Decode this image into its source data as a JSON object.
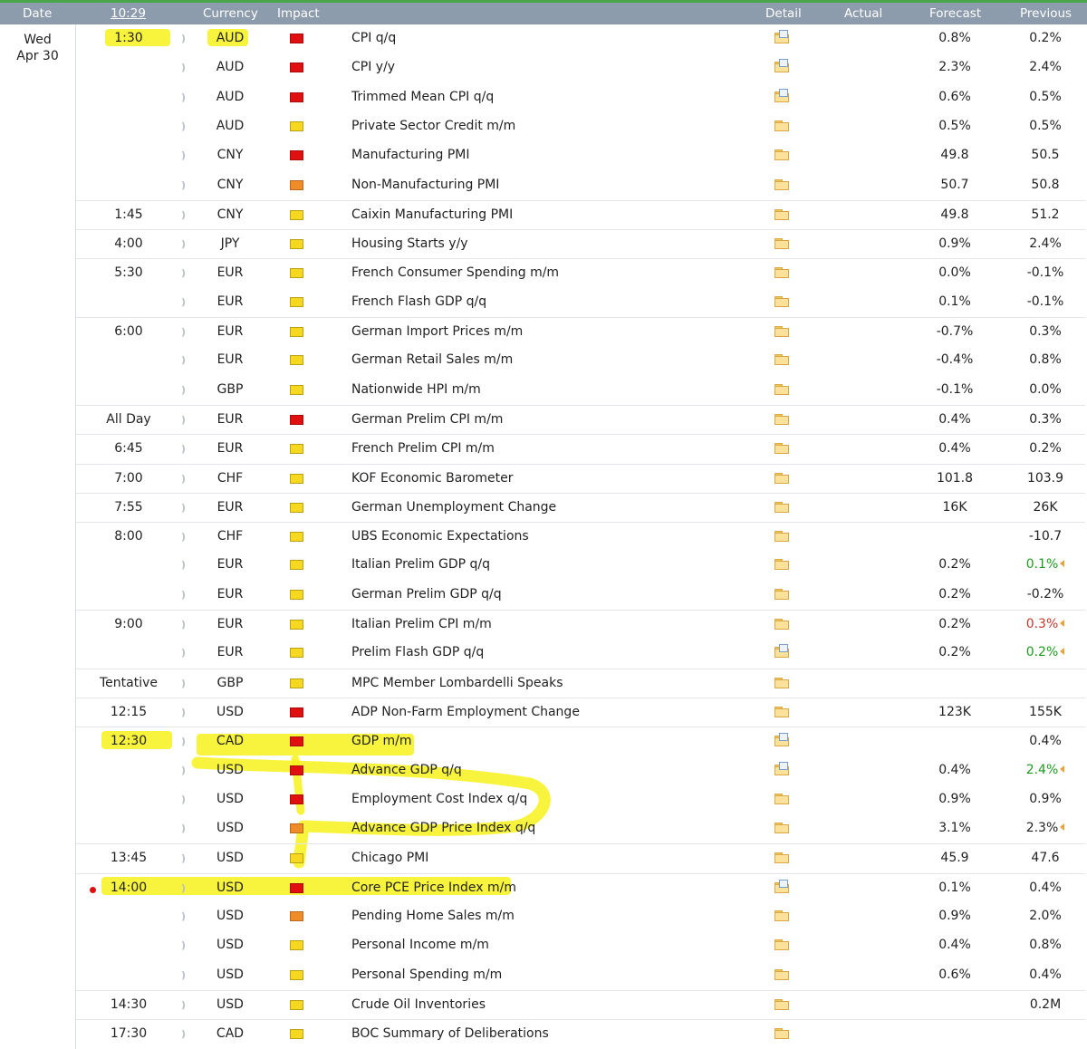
{
  "header": {
    "date": "Date",
    "time": "10:29",
    "currency": "Currency",
    "impact": "Impact",
    "detail": "Detail",
    "actual": "Actual",
    "forecast": "Forecast",
    "previous": "Previous"
  },
  "day": {
    "weekday": "Wed",
    "date": "Apr 30"
  },
  "colors": {
    "high": "#e01010",
    "medium": "#f08c28",
    "low": "#f7d820",
    "highlight": "#f7f21b",
    "header": "#8c9cad"
  },
  "events": [
    {
      "time": "1:30",
      "currency": "AUD",
      "impact": "high",
      "title": "CPI q/q",
      "detail": "doc",
      "actual": "",
      "forecast": "0.8%",
      "previous": "0.2%"
    },
    {
      "time": "",
      "currency": "AUD",
      "impact": "high",
      "title": "CPI y/y",
      "detail": "doc",
      "actual": "",
      "forecast": "2.3%",
      "previous": "2.4%"
    },
    {
      "time": "",
      "currency": "AUD",
      "impact": "high",
      "title": "Trimmed Mean CPI q/q",
      "detail": "doc",
      "actual": "",
      "forecast": "0.6%",
      "previous": "0.5%"
    },
    {
      "time": "",
      "currency": "AUD",
      "impact": "low",
      "title": "Private Sector Credit m/m",
      "detail": "folder",
      "actual": "",
      "forecast": "0.5%",
      "previous": "0.5%"
    },
    {
      "time": "",
      "currency": "CNY",
      "impact": "high",
      "title": "Manufacturing PMI",
      "detail": "folder",
      "actual": "",
      "forecast": "49.8",
      "previous": "50.5"
    },
    {
      "time": "",
      "currency": "CNY",
      "impact": "medium",
      "title": "Non-Manufacturing PMI",
      "detail": "folder",
      "actual": "",
      "forecast": "50.7",
      "previous": "50.8"
    },
    {
      "time": "1:45",
      "currency": "CNY",
      "impact": "low",
      "title": "Caixin Manufacturing PMI",
      "detail": "folder",
      "actual": "",
      "forecast": "49.8",
      "previous": "51.2"
    },
    {
      "time": "4:00",
      "currency": "JPY",
      "impact": "low",
      "title": "Housing Starts y/y",
      "detail": "folder",
      "actual": "",
      "forecast": "0.9%",
      "previous": "2.4%"
    },
    {
      "time": "5:30",
      "currency": "EUR",
      "impact": "low",
      "title": "French Consumer Spending m/m",
      "detail": "folder",
      "actual": "",
      "forecast": "0.0%",
      "previous": "-0.1%"
    },
    {
      "time": "",
      "currency": "EUR",
      "impact": "low",
      "title": "French Flash GDP q/q",
      "detail": "folder",
      "actual": "",
      "forecast": "0.1%",
      "previous": "-0.1%"
    },
    {
      "time": "6:00",
      "currency": "EUR",
      "impact": "low",
      "title": "German Import Prices m/m",
      "detail": "folder",
      "actual": "",
      "forecast": "-0.7%",
      "previous": "0.3%"
    },
    {
      "time": "",
      "currency": "EUR",
      "impact": "low",
      "title": "German Retail Sales m/m",
      "detail": "folder",
      "actual": "",
      "forecast": "-0.4%",
      "previous": "0.8%"
    },
    {
      "time": "",
      "currency": "GBP",
      "impact": "low",
      "title": "Nationwide HPI m/m",
      "detail": "folder",
      "actual": "",
      "forecast": "-0.1%",
      "previous": "0.0%"
    },
    {
      "time": "All Day",
      "currency": "EUR",
      "impact": "high",
      "title": "German Prelim CPI m/m",
      "detail": "folder",
      "actual": "",
      "forecast": "0.4%",
      "previous": "0.3%"
    },
    {
      "time": "6:45",
      "currency": "EUR",
      "impact": "low",
      "title": "French Prelim CPI m/m",
      "detail": "folder",
      "actual": "",
      "forecast": "0.4%",
      "previous": "0.2%"
    },
    {
      "time": "7:00",
      "currency": "CHF",
      "impact": "low",
      "title": "KOF Economic Barometer",
      "detail": "folder",
      "actual": "",
      "forecast": "101.8",
      "previous": "103.9"
    },
    {
      "time": "7:55",
      "currency": "EUR",
      "impact": "low",
      "title": "German Unemployment Change",
      "detail": "folder",
      "actual": "",
      "forecast": "16K",
      "previous": "26K"
    },
    {
      "time": "8:00",
      "currency": "CHF",
      "impact": "low",
      "title": "UBS Economic Expectations",
      "detail": "folder",
      "actual": "",
      "forecast": "",
      "previous": "-10.7"
    },
    {
      "time": "",
      "currency": "EUR",
      "impact": "low",
      "title": "Italian Prelim GDP q/q",
      "detail": "folder",
      "actual": "",
      "forecast": "0.2%",
      "previous": "0.1%",
      "revised": "better"
    },
    {
      "time": "",
      "currency": "EUR",
      "impact": "low",
      "title": "German Prelim GDP q/q",
      "detail": "folder",
      "actual": "",
      "forecast": "0.2%",
      "previous": "-0.2%"
    },
    {
      "time": "9:00",
      "currency": "EUR",
      "impact": "low",
      "title": "Italian Prelim CPI m/m",
      "detail": "folder",
      "actual": "",
      "forecast": "0.2%",
      "previous": "0.3%",
      "revised": "worse"
    },
    {
      "time": "",
      "currency": "EUR",
      "impact": "low",
      "title": "Prelim Flash GDP q/q",
      "detail": "doc",
      "actual": "",
      "forecast": "0.2%",
      "previous": "0.2%",
      "revised": "better"
    },
    {
      "time": "Tentative",
      "currency": "GBP",
      "impact": "low",
      "title": "MPC Member Lombardelli Speaks",
      "detail": "folder",
      "actual": "",
      "forecast": "",
      "previous": ""
    },
    {
      "time": "12:15",
      "currency": "USD",
      "impact": "high",
      "title": "ADP Non-Farm Employment Change",
      "detail": "folder",
      "actual": "",
      "forecast": "123K",
      "previous": "155K"
    },
    {
      "time": "12:30",
      "currency": "CAD",
      "impact": "high",
      "title": "GDP m/m",
      "detail": "doc",
      "actual": "",
      "forecast": "",
      "previous": "0.4%"
    },
    {
      "time": "",
      "currency": "USD",
      "impact": "high",
      "title": "Advance GDP q/q",
      "detail": "doc",
      "actual": "",
      "forecast": "0.4%",
      "previous": "2.4%",
      "revised": "better"
    },
    {
      "time": "",
      "currency": "USD",
      "impact": "high",
      "title": "Employment Cost Index q/q",
      "detail": "folder",
      "actual": "",
      "forecast": "0.9%",
      "previous": "0.9%"
    },
    {
      "time": "",
      "currency": "USD",
      "impact": "medium",
      "title": "Advance GDP Price Index q/q",
      "detail": "folder",
      "actual": "",
      "forecast": "3.1%",
      "previous": "2.3%",
      "revised": "plain"
    },
    {
      "time": "13:45",
      "currency": "USD",
      "impact": "low",
      "title": "Chicago PMI",
      "detail": "folder",
      "actual": "",
      "forecast": "45.9",
      "previous": "47.6"
    },
    {
      "time": "14:00",
      "currency": "USD",
      "impact": "high",
      "title": "Core PCE Price Index m/m",
      "detail": "doc",
      "actual": "",
      "forecast": "0.1%",
      "previous": "0.4%"
    },
    {
      "time": "",
      "currency": "USD",
      "impact": "medium",
      "title": "Pending Home Sales m/m",
      "detail": "folder",
      "actual": "",
      "forecast": "0.9%",
      "previous": "2.0%"
    },
    {
      "time": "",
      "currency": "USD",
      "impact": "low",
      "title": "Personal Income m/m",
      "detail": "folder",
      "actual": "",
      "forecast": "0.4%",
      "previous": "0.8%"
    },
    {
      "time": "",
      "currency": "USD",
      "impact": "low",
      "title": "Personal Spending m/m",
      "detail": "folder",
      "actual": "",
      "forecast": "0.6%",
      "previous": "0.4%"
    },
    {
      "time": "14:30",
      "currency": "USD",
      "impact": "low",
      "title": "Crude Oil Inventories",
      "detail": "folder",
      "actual": "",
      "forecast": "",
      "previous": "0.2M"
    },
    {
      "time": "17:30",
      "currency": "CAD",
      "impact": "low",
      "title": "BOC Summary of Deliberations",
      "detail": "folder",
      "actual": "",
      "forecast": "",
      "previous": ""
    }
  ]
}
